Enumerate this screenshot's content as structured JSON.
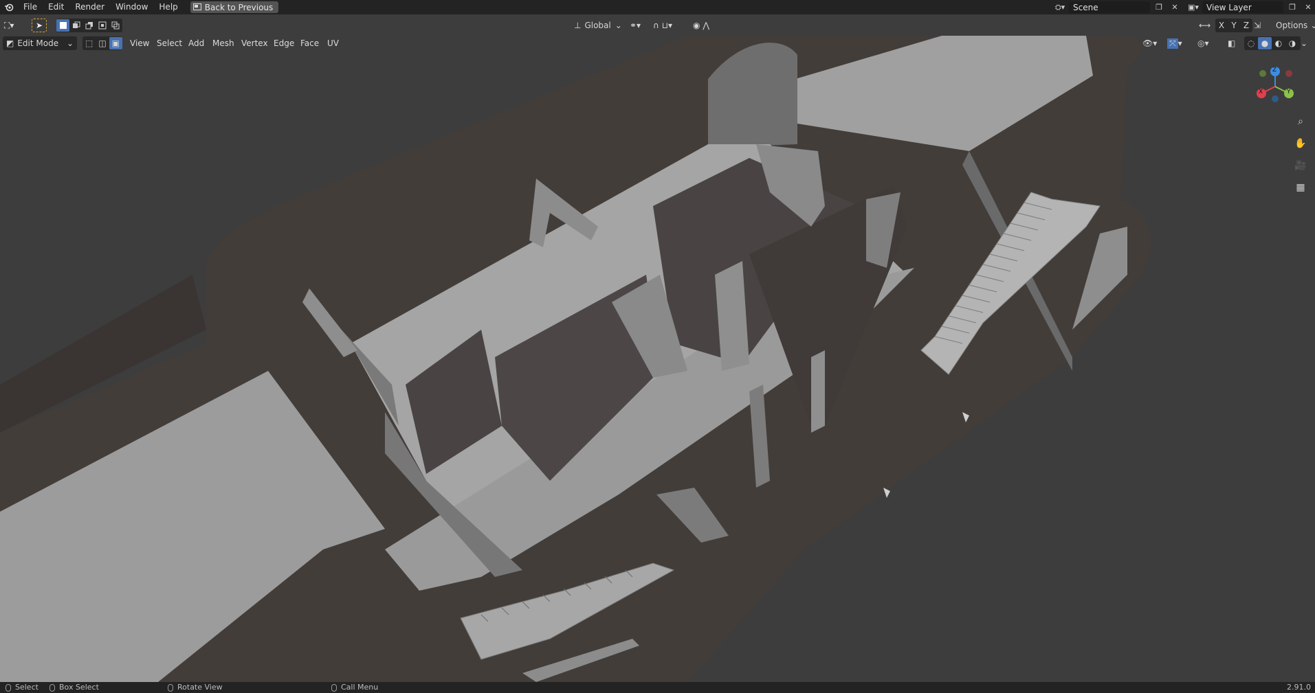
{
  "topbar": {
    "menus": [
      "File",
      "Edit",
      "Render",
      "Window",
      "Help"
    ],
    "back_button": "Back to Previous",
    "scene": "Scene",
    "view_layer": "View Layer"
  },
  "tool_header": {
    "transform_orientation": "Global",
    "axes": [
      "X",
      "Y",
      "Z"
    ],
    "options": "Options"
  },
  "viewport_header": {
    "mode": "Edit Mode",
    "menus": [
      "View",
      "Select",
      "Add",
      "Mesh",
      "Vertex",
      "Edge",
      "Face",
      "UV"
    ]
  },
  "gizmo": {
    "x": "X",
    "y": "Y",
    "z": "Z"
  },
  "statusbar": {
    "select": "Select",
    "box_select": "Box Select",
    "rotate_view": "Rotate View",
    "call_menu": "Call Menu",
    "version": "2.91.0"
  },
  "colors": {
    "topbar": "#232323",
    "viewport": "#3d3d3d",
    "accent": "#4772b3",
    "axis_x": "#e2404f",
    "axis_y": "#8bc34a",
    "axis_z": "#3b8de0"
  }
}
